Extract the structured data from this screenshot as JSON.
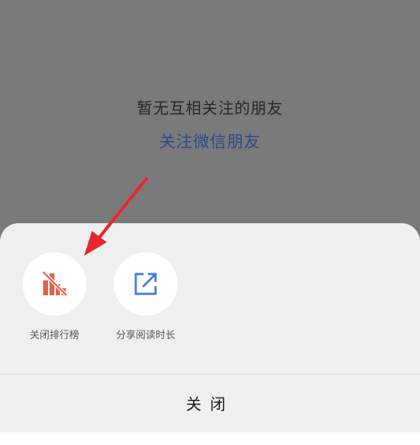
{
  "background": {
    "empty_message": "暂无互相关注的朋友",
    "follow_link": "关注微信朋友"
  },
  "sheet": {
    "actions": [
      {
        "label": "关闭排行榜",
        "icon": "ranking-off-icon",
        "icon_color": "#e0644c"
      },
      {
        "label": "分享阅读时长",
        "icon": "share-icon",
        "icon_color": "#3d7ae0"
      }
    ],
    "close_label": "关闭"
  },
  "annotation": {
    "arrow_color": "#e8262b"
  }
}
